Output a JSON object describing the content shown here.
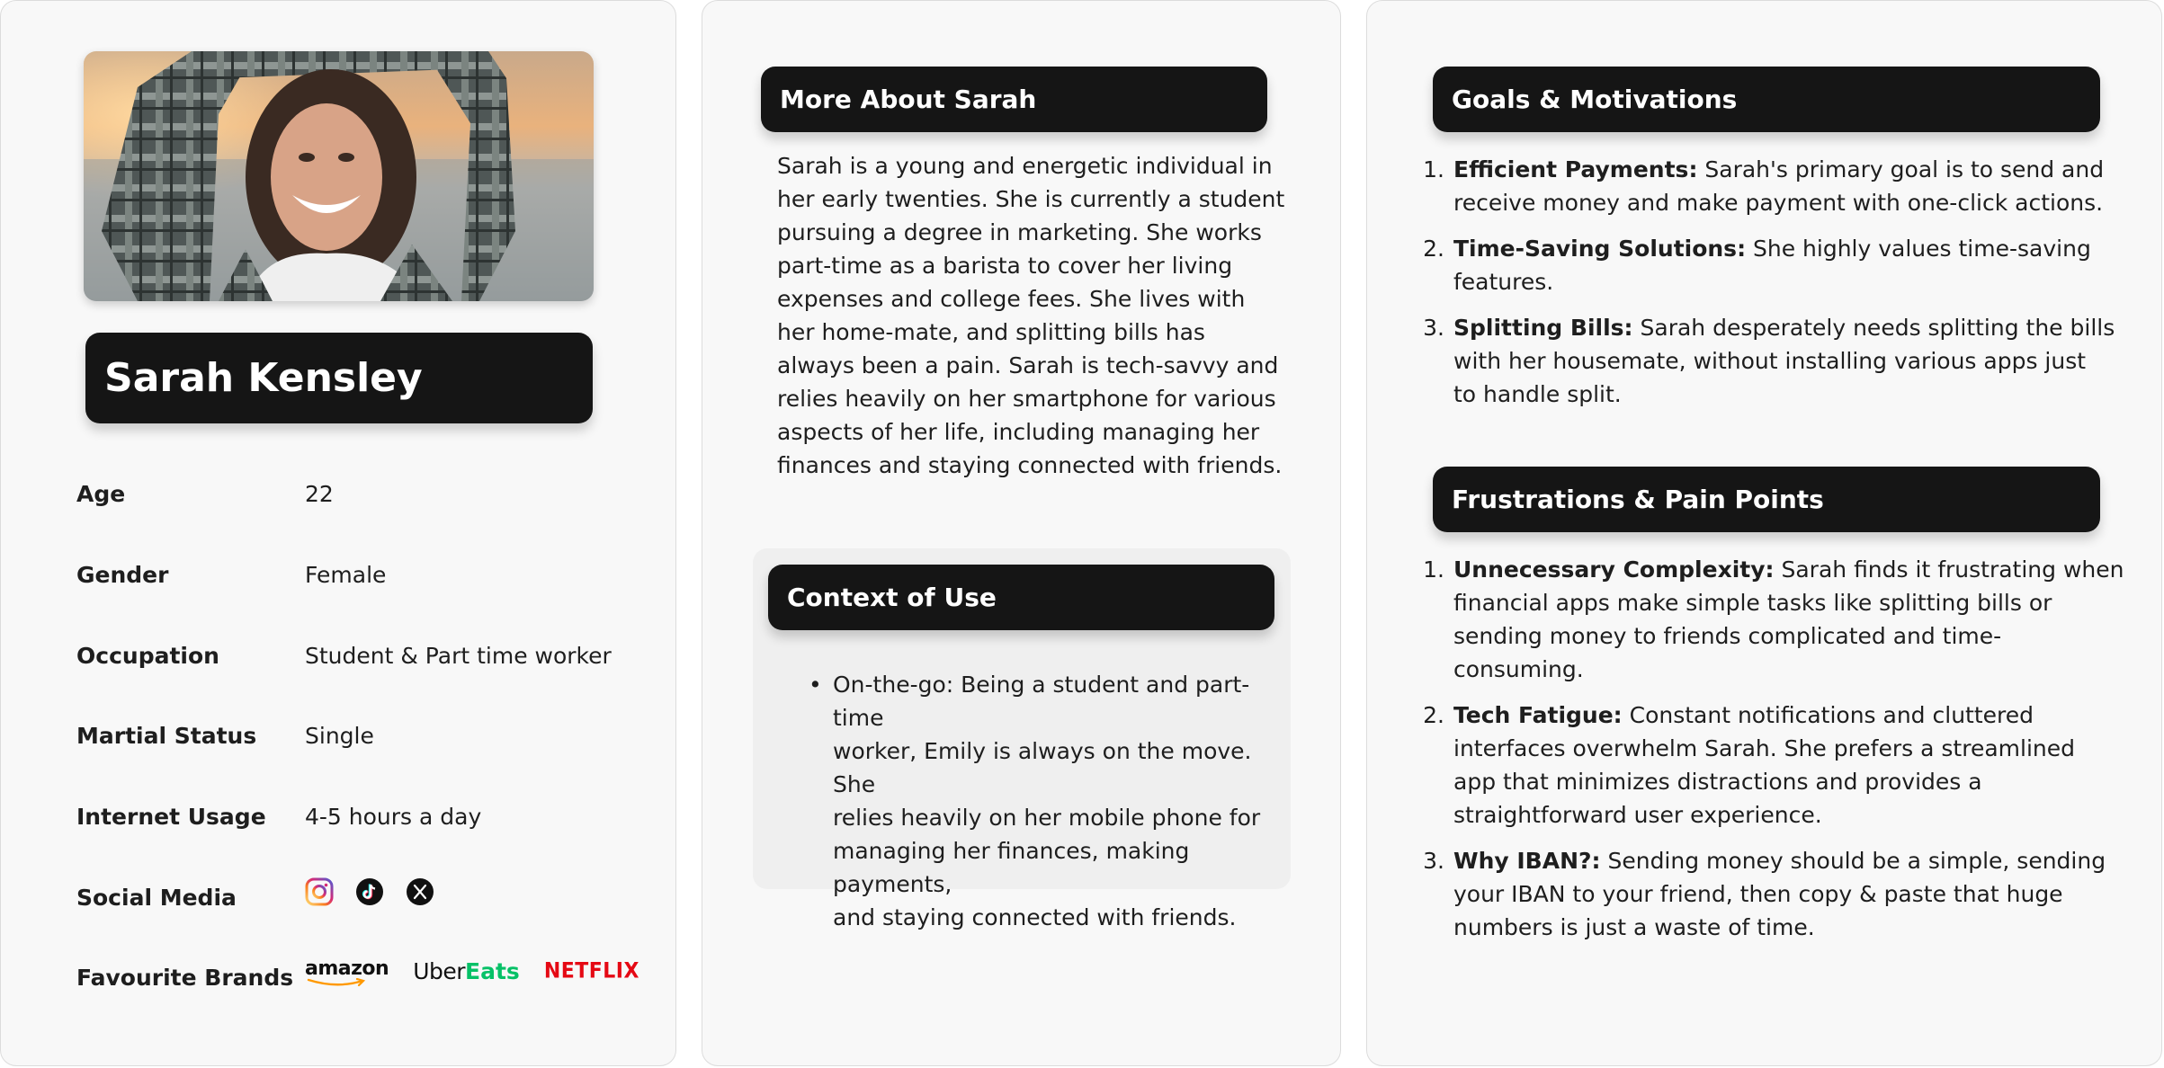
{
  "profile": {
    "photo_alt": "Portrait of a smiling young woman with arms raised at sunset by the sea",
    "name": "Sarah Kensley",
    "attributes": [
      {
        "label": "Age",
        "value": "22"
      },
      {
        "label": "Gender",
        "value": "Female"
      },
      {
        "label": "Occupation",
        "value": "Student & Part time worker"
      },
      {
        "label": "Martial Status",
        "value": "Single"
      },
      {
        "label": "Internet Usage",
        "value": "4-5 hours a day"
      }
    ],
    "social_media": {
      "label": "Social Media",
      "icons": [
        "instagram-icon",
        "tiktok-icon",
        "x-icon"
      ]
    },
    "brands": {
      "label": "Favourite Brands",
      "amazon": "amazon",
      "uber": "Uber",
      "eats": "Eats",
      "netflix": "NETFLIX"
    }
  },
  "about": {
    "title": "More About Sarah",
    "lines": [
      "Sarah is a young and energetic individual in",
      "her early twenties. She is currently a student",
      "pursuing a degree in marketing. She works",
      "part-time as a barista to cover her living",
      "expenses and college fees. She lives with",
      "her home-mate, and splitting bills has",
      "always been a pain. Sarah is tech-savvy and",
      "relies heavily on her smartphone for various",
      "aspects of her life, including managing her",
      "finances and staying connected with friends."
    ]
  },
  "context": {
    "title": "Context of Use",
    "bullet_lines": [
      "On-the-go: Being a student and part-time",
      "worker, Emily is always on the move. She",
      "relies heavily on her mobile phone for",
      "managing her finances, making payments,",
      "and staying connected with friends."
    ]
  },
  "goals": {
    "title": "Goals & Motivations",
    "items": [
      {
        "num": "1.",
        "title": "Efficient Payments:",
        "first": "Sarah's primary goal is to send and",
        "rest": [
          "receive money and make payment with one-click actions."
        ]
      },
      {
        "num": "2.",
        "title": "Time-Saving Solutions:",
        "first": "She highly values time-saving",
        "rest": [
          "features."
        ]
      },
      {
        "num": "3.",
        "title": "Splitting Bills:",
        "first": "Sarah desperately needs splitting the bills",
        "rest": [
          "with her housemate, without installing various apps just",
          "to handle split."
        ]
      }
    ]
  },
  "frustrations": {
    "title": "Frustrations & Pain Points",
    "items": [
      {
        "num": "1.",
        "title": "Unnecessary Complexity:",
        "first": "Sarah finds it frustrating when",
        "rest": [
          "financial apps make simple tasks like splitting bills or",
          "sending money to friends complicated and time-",
          "consuming."
        ]
      },
      {
        "num": "2.",
        "title": "Tech Fatigue:",
        "first": "Constant notifications and cluttered",
        "rest": [
          "interfaces overwhelm Sarah. She prefers a streamlined",
          "app that minimizes distractions and provides a",
          "straightforward user experience."
        ]
      },
      {
        "num": "3.",
        "title": "Why IBAN?:",
        "first": "Sending money should be a simple, sending",
        "rest": [
          "your IBAN to your friend, then copy & paste that huge",
          "numbers is just a waste of time."
        ]
      }
    ]
  }
}
